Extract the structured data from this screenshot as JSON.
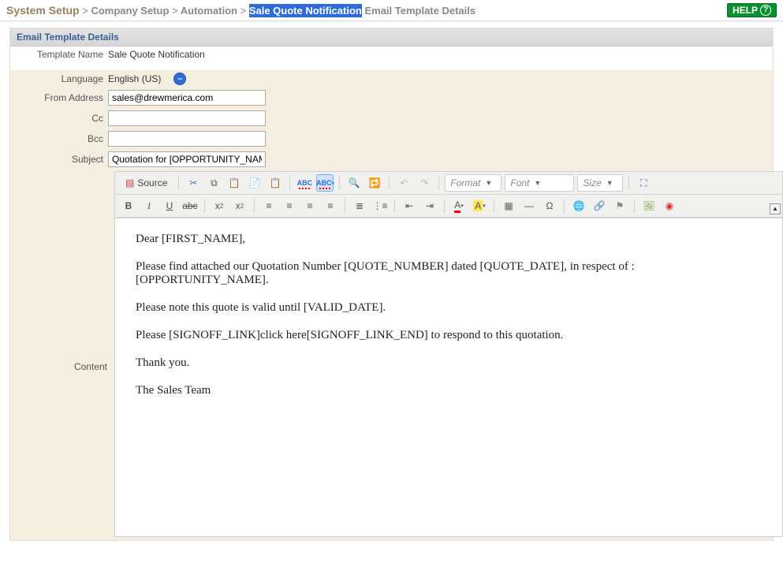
{
  "help_label": "HELP",
  "breadcrumb": {
    "root": "System Setup",
    "level2": "Company Setup",
    "level3": "Automation",
    "highlight": "Sale Quote Notification",
    "tail": "Email Template Details",
    "sep": ">"
  },
  "section_title": "Email Template Details",
  "labels": {
    "template_name": "Template Name",
    "language": "Language",
    "from": "From Address",
    "cc": "Cc",
    "bcc": "Bcc",
    "subject": "Subject",
    "content": "Content"
  },
  "values": {
    "template_name": "Sale Quote Notification",
    "language": "English (US)",
    "from": "sales@drewmerica.com",
    "cc": "",
    "bcc": "",
    "subject": "Quotation for [OPPORTUNITY_NAM"
  },
  "toolbar": {
    "source": "Source",
    "format": "Format",
    "font": "Font",
    "size": "Size"
  },
  "body": {
    "p1": "Dear [FIRST_NAME],",
    "p2": "Please find attached our Quotation Number [QUOTE_NUMBER] dated [QUOTE_DATE], in respect of : [OPPORTUNITY_NAME].",
    "p3": "Please note this quote is valid until [VALID_DATE].",
    "p4": "Please [SIGNOFF_LINK]click here[SIGNOFF_LINK_END] to respond to this quotation.",
    "p5": "Thank you.",
    "p6": "The Sales Team"
  }
}
